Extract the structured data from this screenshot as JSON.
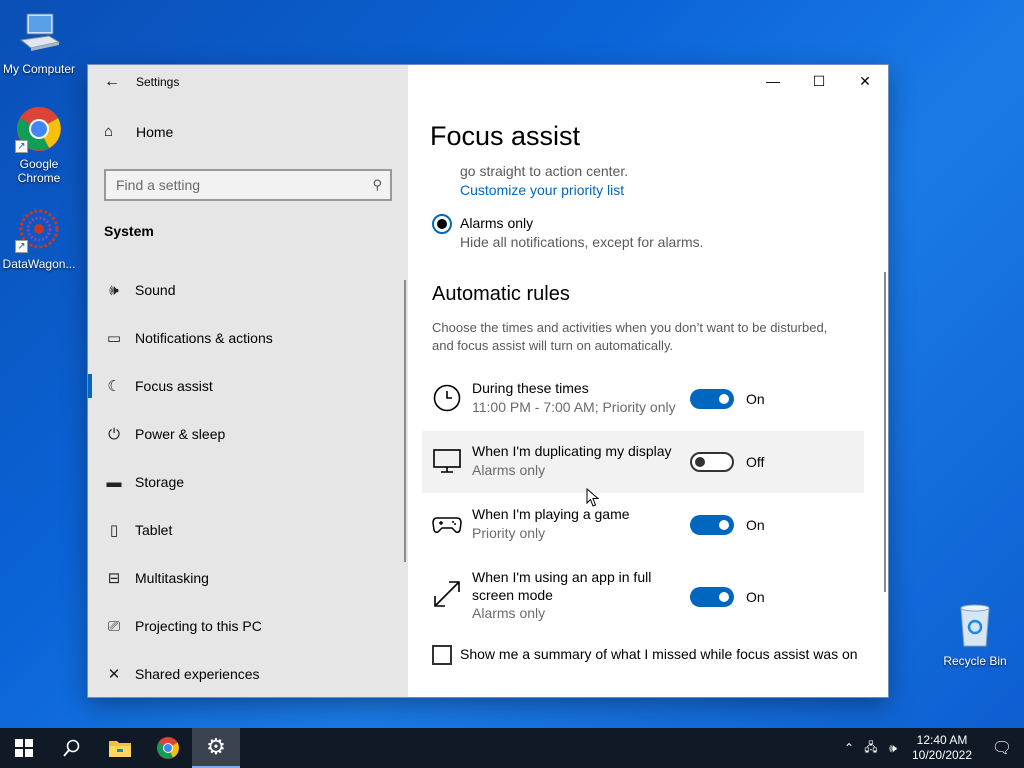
{
  "desktop": {
    "icons": [
      {
        "label": "My Computer"
      },
      {
        "label": "Google Chrome"
      },
      {
        "label": "DataWagon..."
      },
      {
        "label": "Recycle Bin"
      }
    ]
  },
  "window": {
    "app_title": "Settings",
    "home_label": "Home",
    "search_placeholder": "Find a setting",
    "section_label": "System",
    "nav_items": [
      {
        "label": "Sound",
        "icon": "speaker-icon"
      },
      {
        "label": "Notifications & actions",
        "icon": "notification-icon"
      },
      {
        "label": "Focus assist",
        "icon": "moon-icon",
        "active": true
      },
      {
        "label": "Power & sleep",
        "icon": "power-icon"
      },
      {
        "label": "Storage",
        "icon": "storage-icon"
      },
      {
        "label": "Tablet",
        "icon": "tablet-icon"
      },
      {
        "label": "Multitasking",
        "icon": "multitasking-icon"
      },
      {
        "label": "Projecting to this PC",
        "icon": "projecting-icon"
      },
      {
        "label": "Shared experiences",
        "icon": "shared-icon"
      }
    ]
  },
  "content": {
    "title": "Focus assist",
    "priority_desc_tail": "go straight to action center.",
    "priority_link": "Customize your priority list",
    "alarms_label": "Alarms only",
    "alarms_desc": "Hide all notifications, except for alarms.",
    "auto_rules_title": "Automatic rules",
    "auto_rules_desc_1": "Choose the times and activities when you don’t want to be disturbed,",
    "auto_rules_desc_2": "and focus assist will turn on automatically.",
    "rules": [
      {
        "title": "During these times",
        "subtitle": "11:00 PM - 7:00 AM; Priority only",
        "state": "On",
        "on": true,
        "icon": "clock-icon"
      },
      {
        "title": "When I'm duplicating my display",
        "subtitle": "Alarms only",
        "state": "Off",
        "on": false,
        "icon": "monitor-icon"
      },
      {
        "title": "When I'm playing a game",
        "subtitle": "Priority only",
        "state": "On",
        "on": true,
        "icon": "gamepad-icon"
      },
      {
        "title_line1": "When I'm using an app in full",
        "title_line2": "screen mode",
        "subtitle": "Alarms only",
        "state": "On",
        "on": true,
        "icon": "fullscreen-icon"
      }
    ],
    "summary_checkbox_label": "Show me a summary of what I missed while focus assist was on"
  },
  "taskbar": {
    "time": "12:40 AM",
    "date": "10/20/2022"
  }
}
